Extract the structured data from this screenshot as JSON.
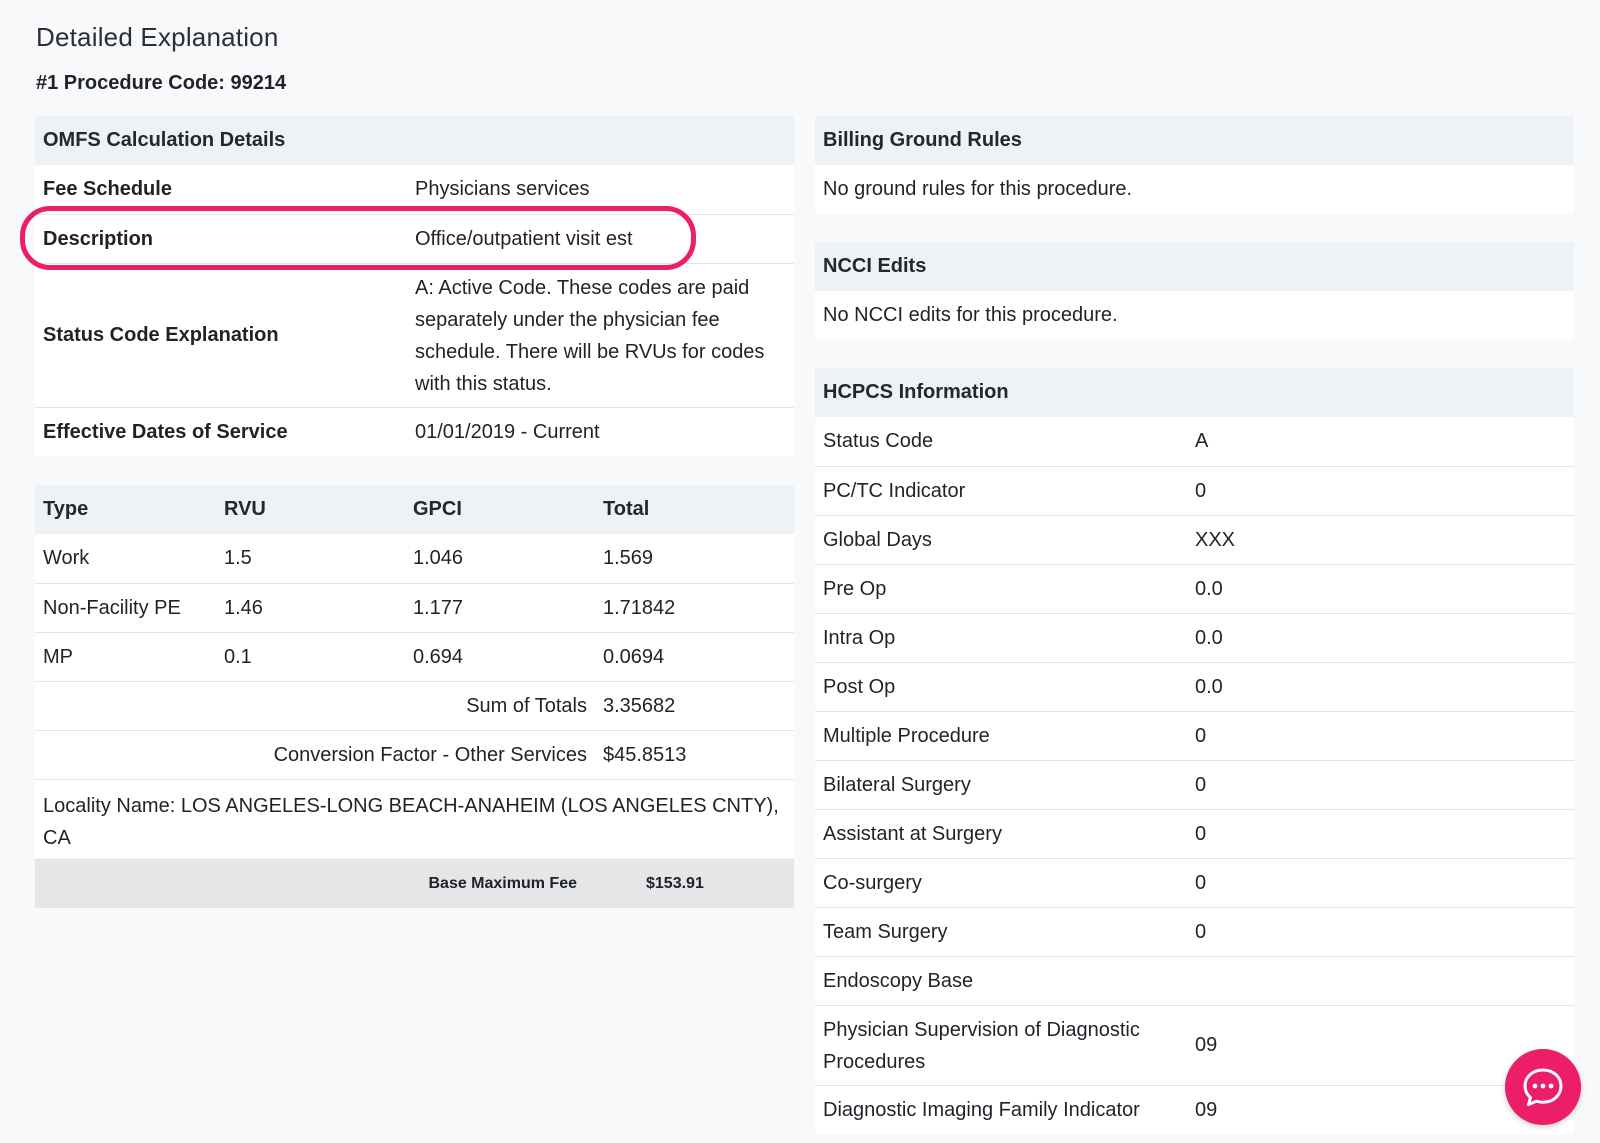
{
  "page": {
    "title": "Detailed Explanation",
    "procedure_code_label": "#1 Procedure Code: 99214"
  },
  "omfs": {
    "header": "OMFS Calculation Details",
    "rows": [
      {
        "key": "Fee Schedule",
        "value": "Physicians services"
      },
      {
        "key": "Description",
        "value": "Office/outpatient visit est"
      },
      {
        "key": "Status Code Explanation",
        "value": "A: Active Code. These codes are paid separately under the physician fee schedule. There will be RVUs for codes with this status."
      },
      {
        "key": "Effective Dates of Service",
        "value": "01/01/2019 - Current"
      }
    ]
  },
  "rvu_table": {
    "columns": [
      "Type",
      "RVU",
      "GPCI",
      "Total"
    ],
    "rows": [
      [
        "Work",
        "1.5",
        "1.046",
        "1.569"
      ],
      [
        "Non-Facility PE",
        "1.46",
        "1.177",
        "1.71842"
      ],
      [
        "MP",
        "0.1",
        "0.694",
        "0.0694"
      ]
    ],
    "sum_label": "Sum of Totals",
    "sum_value": "3.35682",
    "conversion_label": "Conversion Factor - Other Services",
    "conversion_value": "$45.8513",
    "locality": "Locality Name: LOS ANGELES-LONG BEACH-ANAHEIM (LOS ANGELES CNTY), CA",
    "base_label": "Base Maximum Fee",
    "base_value": "$153.91"
  },
  "billing_ground_rules": {
    "header": "Billing Ground Rules",
    "text": "No ground rules for this procedure."
  },
  "ncci": {
    "header": "NCCI Edits",
    "text": "No NCCI edits for this procedure."
  },
  "hcpcs": {
    "header": "HCPCS Information",
    "rows": [
      {
        "key": "Status Code",
        "value": "A"
      },
      {
        "key": "PC/TC Indicator",
        "value": "0"
      },
      {
        "key": "Global Days",
        "value": "XXX"
      },
      {
        "key": "Pre Op",
        "value": "0.0"
      },
      {
        "key": "Intra Op",
        "value": "0.0"
      },
      {
        "key": "Post Op",
        "value": "0.0"
      },
      {
        "key": "Multiple Procedure",
        "value": "0"
      },
      {
        "key": "Bilateral Surgery",
        "value": "0"
      },
      {
        "key": "Assistant at Surgery",
        "value": "0"
      },
      {
        "key": "Co-surgery",
        "value": "0"
      },
      {
        "key": "Team Surgery",
        "value": "0"
      },
      {
        "key": "Endoscopy Base",
        "value": ""
      },
      {
        "key": "Physician Supervision of Diagnostic Procedures",
        "value": "09"
      },
      {
        "key": "Diagnostic Imaging Family Indicator",
        "value": "09"
      }
    ]
  },
  "chat_button": {
    "icon": "chat-bubble-icon",
    "color": "#ec1e6a"
  },
  "highlight": {
    "color": "#ec1e6a",
    "target": "Description"
  }
}
